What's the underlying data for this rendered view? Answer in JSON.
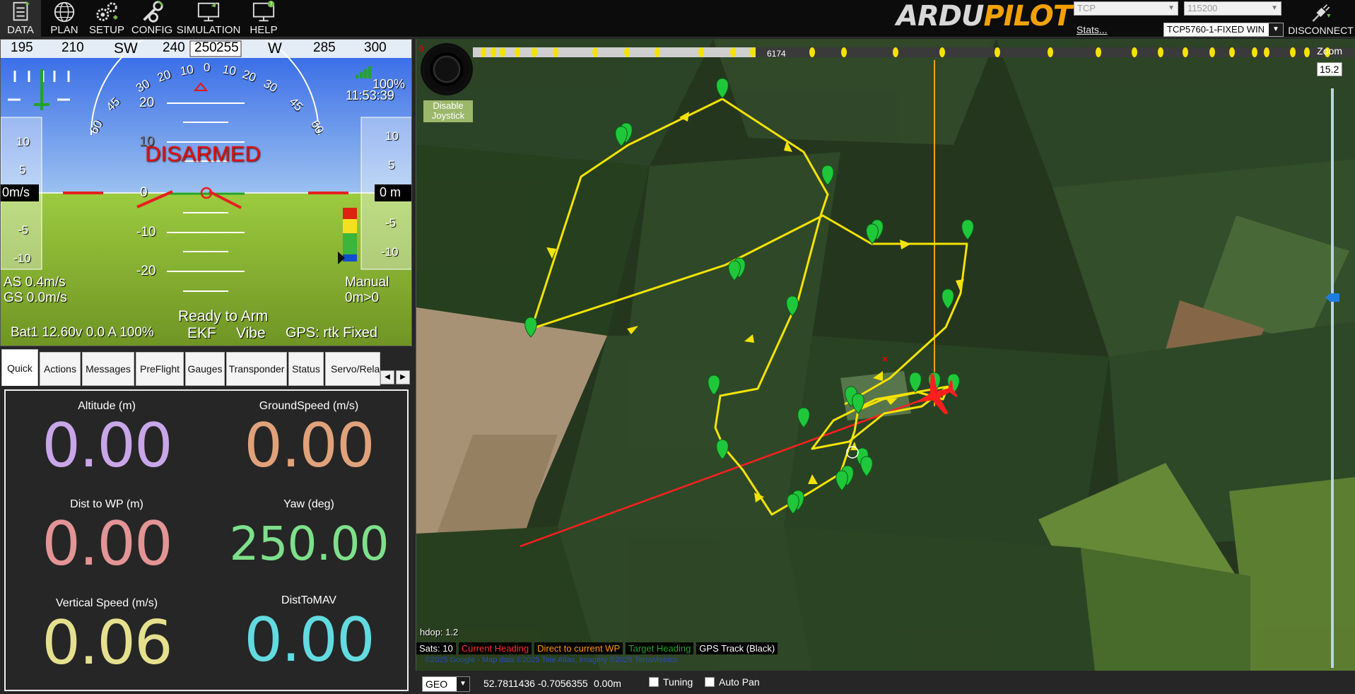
{
  "menu": [
    {
      "label": "DATA",
      "icon": "data-icon"
    },
    {
      "label": "PLAN",
      "icon": "plan-globe-icon"
    },
    {
      "label": "SETUP",
      "icon": "setup-gears-icon"
    },
    {
      "label": "CONFIG",
      "icon": "config-wrench-icon"
    },
    {
      "label": "SIMULATION",
      "icon": "simulation-monitor-icon"
    },
    {
      "label": "HELP",
      "icon": "help-monitor-icon"
    }
  ],
  "logo": {
    "part1": "ARDU",
    "part2": "PILOT"
  },
  "connection": {
    "type": "TCP",
    "baud": "115200",
    "stats_link": "Stats...",
    "vehicle": "TCP5760-1-FIXED WIN",
    "disconnect_label": "DISCONNECT"
  },
  "hud": {
    "heading_ticks": [
      "195",
      "210",
      "SW",
      "240",
      "250",
      "255",
      "W",
      "285",
      "300"
    ],
    "status": "DISARMED",
    "airspeed_box": "0m/s",
    "altitude_box": "0 m",
    "link_quality": "100%",
    "time": "11:53:39",
    "as": "AS 0.4m/s",
    "gs": "GS 0.0m/s",
    "mode": "Manual",
    "alt_wp": "0m>0",
    "ready": "Ready to Arm",
    "ekf": "EKF",
    "vibe": "Vibe",
    "gps": "GPS: rtk Fixed",
    "battery": "Bat1 12.60v 0.0 A 100%",
    "pitch_labels": [
      "20",
      "10",
      "0",
      "-10",
      "-20"
    ],
    "speed_scale": [
      "10",
      "5",
      "0",
      "-5",
      "-10"
    ],
    "alt_scale": [
      "10",
      "5",
      "0",
      "-5",
      "-10"
    ],
    "roll_labels": [
      "60",
      "45",
      "30",
      "20",
      "10",
      "0",
      "10",
      "20",
      "30",
      "45",
      "60"
    ]
  },
  "tabs": [
    "Quick",
    "Actions",
    "Messages",
    "PreFlight",
    "Gauges",
    "Transponder",
    "Status",
    "Servo/Relay"
  ],
  "quick": [
    {
      "label": "Altitude (m)",
      "value": "0.00",
      "color": "#c8a6e8"
    },
    {
      "label": "GroundSpeed (m/s)",
      "value": "0.00",
      "color": "#e0a27a"
    },
    {
      "label": "Dist to WP (m)",
      "value": "0.00",
      "color": "#e39494"
    },
    {
      "label": "Yaw (deg)",
      "value": "250.00",
      "color": "#7ee08a"
    },
    {
      "label": "Vertical Speed (m/s)",
      "value": "0.06",
      "color": "#e4e08e"
    },
    {
      "label": "DistToMAV",
      "value": "0.00",
      "color": "#62dbe0"
    }
  ],
  "map": {
    "zoom_label": "Zoom",
    "zoom_value": "15.2",
    "joystick_button": "Disable Joystick",
    "distance_marker": "6174",
    "progress_zero": "0",
    "hdop": "hdop: 1.2",
    "legend": [
      {
        "label": "Sats: 10",
        "color": "#ffffff"
      },
      {
        "label": "Current Heading",
        "color": "#ff2b2b"
      },
      {
        "label": "Direct to current WP",
        "color": "#ff9a00"
      },
      {
        "label": "Target Heading",
        "color": "#21a32b"
      },
      {
        "label": "GPS Track (Black)",
        "color": "#ffffff"
      }
    ],
    "copyright": "©2025 Google - Map data ©2025 Tele Atlas, Imagery ©2025 TerraMetrics"
  },
  "bottom": {
    "coord_mode": "GEO",
    "coords": "52.7811436 -0.7056355",
    "alt": "0.00m",
    "tuning_label": "Tuning",
    "autopan_label": "Auto Pan"
  }
}
